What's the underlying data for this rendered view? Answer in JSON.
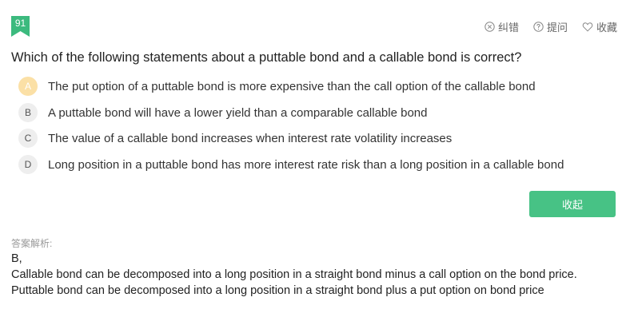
{
  "question_number": "91",
  "actions": {
    "report": "纠错",
    "ask": "提问",
    "favorite": "收藏"
  },
  "question": {
    "text": "Which of the following statements about a puttable bond and a callable bond is correct?"
  },
  "options": [
    {
      "letter": "A",
      "text": "The put option of a puttable bond is more expensive than the call option of the callable bond",
      "selected": true
    },
    {
      "letter": "B",
      "text": "A puttable bond will have a lower yield than a comparable callable bond",
      "selected": false
    },
    {
      "letter": "C",
      "text": "The value of a callable bond increases when interest rate volatility increases",
      "selected": false
    },
    {
      "letter": "D",
      "text": "Long position in a puttable bond has more interest rate risk than a long position in a callable bond",
      "selected": false
    }
  ],
  "collapse_button": {
    "label": "收起"
  },
  "analysis": {
    "label": "答案解析:",
    "answer": "B,",
    "explanation": "Callable bond can be decomposed into a long position in a straight bond minus a call option on the bond price. Puttable bond can be decomposed into a long position in a straight bond plus a put option on bond price"
  },
  "colors": {
    "accent_green": "#47c285",
    "badge_green": "#3cba7e",
    "selected_option": "#fbe0a6",
    "option_circle": "#eeeeee",
    "muted_text": "#999999"
  },
  "icons": [
    "close-circle-icon",
    "question-circle-icon",
    "heart-icon"
  ]
}
